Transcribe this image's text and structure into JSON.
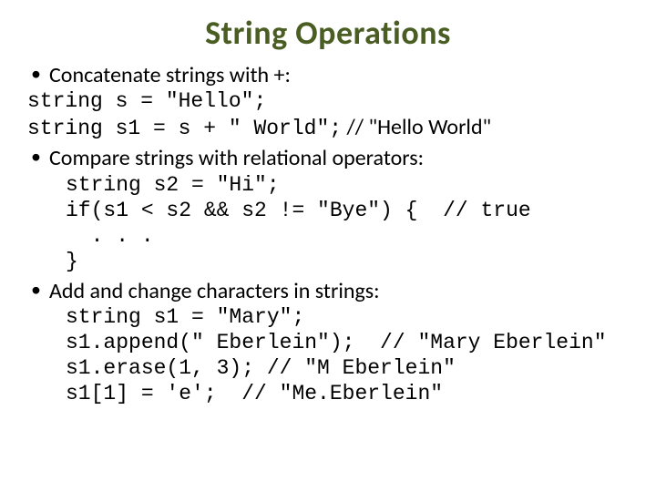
{
  "title": "String Operations",
  "bullets": {
    "b1": "Concatenate strings with +:",
    "b1_code1": "string s = \"Hello\";",
    "b1_code2a": "string s1 = s + \" World\";",
    "b1_code2b": " // \"Hello World\"",
    "b2": "Compare strings with relational operators:",
    "b2_code1": "string s2 = \"Hi\";",
    "b2_code2": "if(s1 < s2 && s2 != \"Bye\") {  // true",
    "b2_code3": "  . . .",
    "b2_code4": "}",
    "b3": "Add and change characters in strings:",
    "b3_code1": "string s1 = \"Mary\";",
    "b3_code2": "s1.append(\" Eberlein\");  // \"Mary Eberlein\"",
    "b3_code3": "s1.erase(1, 3); // \"M Eberlein\"",
    "b3_code4": "s1[1] = 'e';  // \"Me.Eberlein\""
  }
}
